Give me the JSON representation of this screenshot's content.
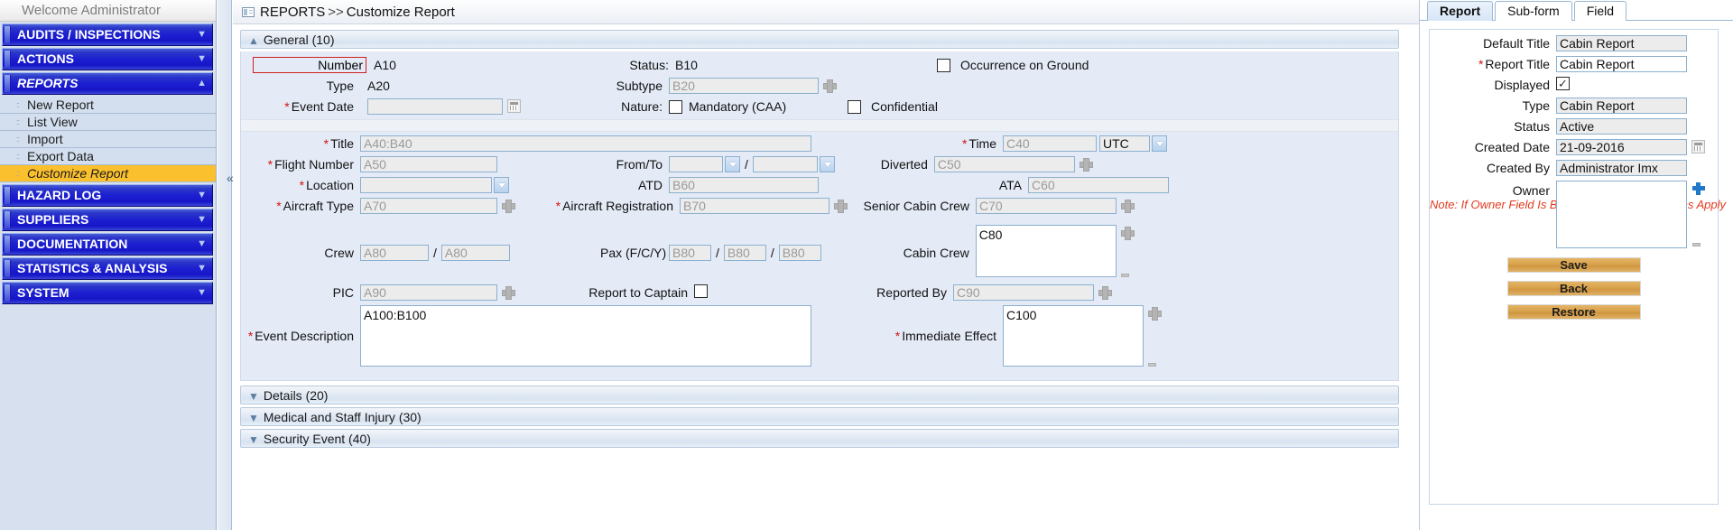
{
  "sidebar": {
    "welcome": "Welcome  Administrator",
    "groups": [
      {
        "label": "AUDITS / INSPECTIONS",
        "state": "collapsed",
        "chevron": "chevron-down"
      },
      {
        "label": "ACTIONS",
        "state": "collapsed",
        "chevron": "chevron-down"
      },
      {
        "label": "REPORTS",
        "state": "expanded",
        "chevron": "chevron-up"
      },
      {
        "label": "HAZARD LOG",
        "state": "collapsed",
        "chevron": "chevron-down"
      },
      {
        "label": "SUPPLIERS",
        "state": "collapsed",
        "chevron": "chevron-down"
      },
      {
        "label": "DOCUMENTATION",
        "state": "collapsed",
        "chevron": "chevron-down"
      },
      {
        "label": "STATISTICS & ANALYSIS",
        "state": "collapsed",
        "chevron": "chevron-down"
      },
      {
        "label": "SYSTEM",
        "state": "collapsed",
        "chevron": "chevron-down"
      }
    ],
    "reports_items": [
      {
        "label": "New Report",
        "selected": false
      },
      {
        "label": "List View",
        "selected": false
      },
      {
        "label": "Import",
        "selected": false
      },
      {
        "label": "Export Data",
        "selected": false
      },
      {
        "label": "Customize Report",
        "selected": true
      }
    ],
    "collapse_handle": "«"
  },
  "breadcrumb": {
    "icon": "report-icon",
    "root": "REPORTS",
    "separator": ">>",
    "current": "Customize Report"
  },
  "sections": {
    "general": "General (10)",
    "details": "Details (20)",
    "medical": "Medical and Staff Injury (30)",
    "security": "Security Event (40)"
  },
  "form": {
    "number_label": "Number",
    "number_value": "A10",
    "type_label": "Type",
    "type_value": "A20",
    "event_date_label": "Event Date",
    "event_date_value": "",
    "title_label": "Title",
    "title_value": "A40:B40",
    "flight_number_label": "Flight Number",
    "flight_number_value": "A50",
    "location_label": "Location",
    "location_value": "",
    "aircraft_type_label": "Aircraft Type",
    "aircraft_type_value": "A70",
    "crew_label": "Crew",
    "crew_value_1": "A80",
    "crew_value_2": "A80",
    "pic_label": "PIC",
    "pic_value": "A90",
    "event_description_label": "Event Description",
    "event_description_value": "A100:B100",
    "status_label": "Status:",
    "status_value": "B10",
    "subtype_label": "Subtype",
    "subtype_value": "B20",
    "nature_label": "Nature:",
    "nature_option": "Mandatory (CAA)",
    "from_to_label": "From/To",
    "from_value": "",
    "to_value": "",
    "atd_label": "ATD",
    "atd_value": "B60",
    "aircraft_registration_label": "Aircraft Registration",
    "aircraft_registration_value": "B70",
    "pax_label": "Pax (F/C/Y)",
    "pax_f": "B80",
    "pax_c": "B80",
    "pax_y": "B80",
    "report_to_captain_label": "Report to Captain",
    "occurrence_on_ground_label": "Occurrence on Ground",
    "confidential_label": "Confidential",
    "time_label": "Time",
    "time_value": "C40",
    "time_zone_value": "UTC",
    "diverted_label": "Diverted",
    "diverted_value": "C50",
    "ata_label": "ATA",
    "ata_value": "C60",
    "senior_cabin_crew_label": "Senior Cabin Crew",
    "senior_cabin_crew_value": "C70",
    "cabin_crew_label": "Cabin Crew",
    "cabin_crew_value": "C80",
    "reported_by_label": "Reported By",
    "reported_by_value": "C90",
    "immediate_effect_label": "Immediate Effect",
    "immediate_effect_value": "C100"
  },
  "rightpanel": {
    "tabs": [
      {
        "label": "Report",
        "active": true
      },
      {
        "label": "Sub-form",
        "active": false
      },
      {
        "label": "Field",
        "active": false
      }
    ],
    "fields": {
      "default_title_label": "Default Title",
      "default_title_value": "Cabin Report",
      "report_title_label": "Report Title",
      "report_title_value": "Cabin Report",
      "displayed_label": "Displayed",
      "displayed_checked": "✓",
      "type_label": "Type",
      "type_value": "Cabin Report",
      "status_label": "Status",
      "status_value": "Active",
      "created_date_label": "Created Date",
      "created_date_value": "21-09-2016",
      "created_by_label": "Created By",
      "created_by_value": "Administrator Imx",
      "owner_label": "Owner",
      "owner_note": "Note: If Owner Field Is Blank, No View Restrictions Apply",
      "owner_value": ""
    },
    "buttons": {
      "save": "Save",
      "back": "Back",
      "restore": "Restore"
    }
  },
  "colors": {
    "nav_blue": "#1c1fd0",
    "selected_yellow": "#fbc02d",
    "required_red": "#d41111",
    "note_red": "#e23b1f",
    "button_gold": "#d9a24c",
    "panel_blue": "#e4ebf7"
  }
}
